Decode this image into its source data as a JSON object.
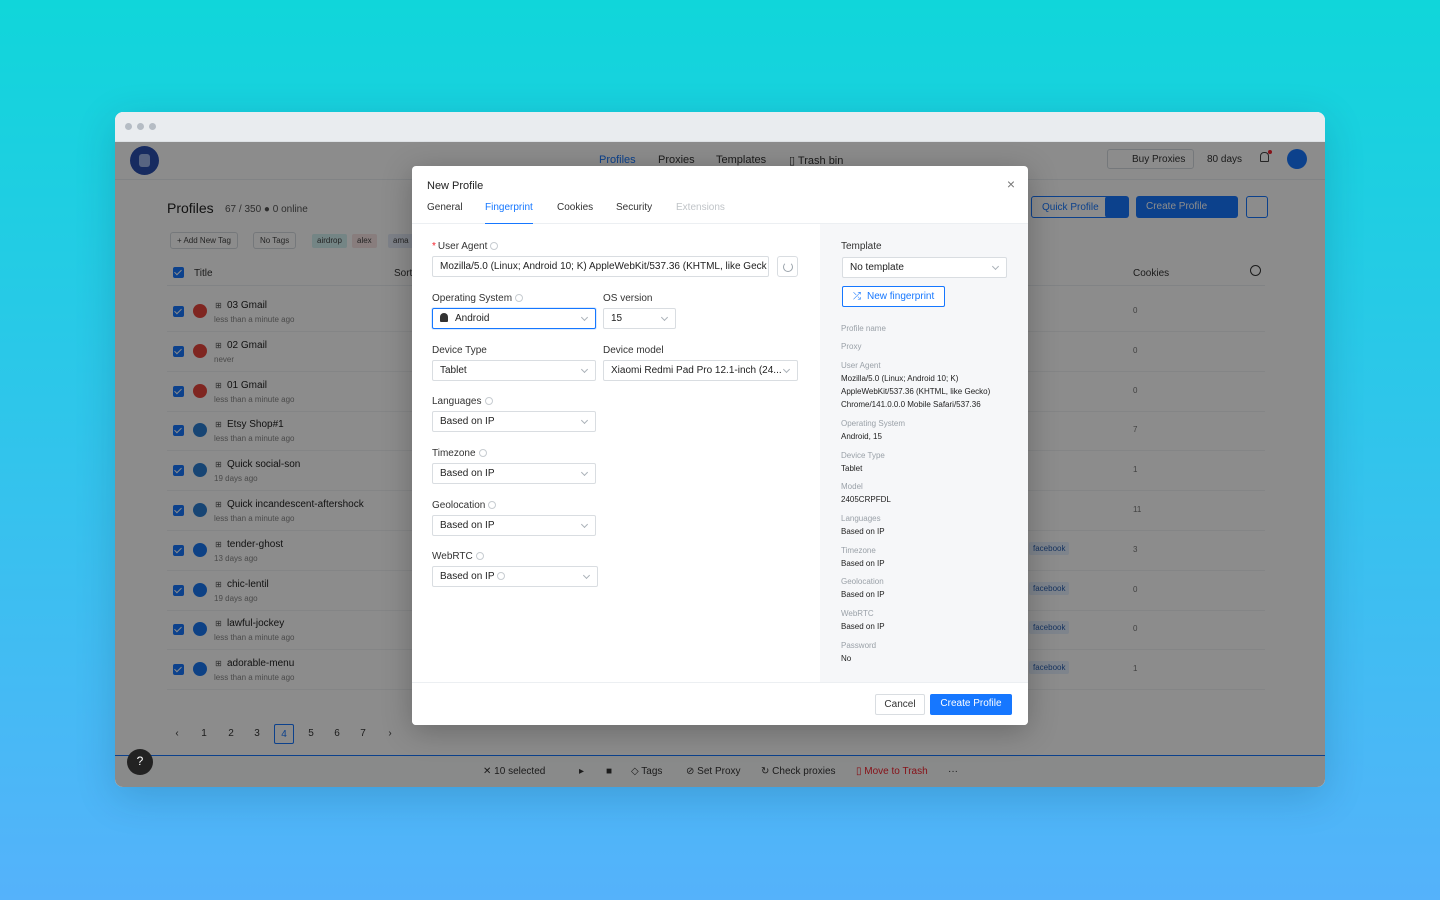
{
  "app": {
    "nav": [
      "Profiles",
      "Proxies",
      "Templates",
      "Trash bin"
    ],
    "buy_proxies": "Buy Proxies",
    "days": "80 days",
    "profiles_title": "Profiles",
    "profiles_count": "67 / 350",
    "online": "0 online",
    "add_new_tag": "Add New Tag",
    "no_tags": "No Tags",
    "chips": [
      "airdrop",
      "alex",
      "ama"
    ],
    "quick_profile": "Quick Profile",
    "create_profile": "Create Profile",
    "col_title": "Title",
    "col_sort": "Sort",
    "col_cookies": "Cookies",
    "rows": [
      {
        "title": "03 Gmail",
        "sub": "less than a minute ago",
        "cookies": "0",
        "tag": ""
      },
      {
        "title": "02 Gmail",
        "sub": "never",
        "cookies": "0",
        "tag": ""
      },
      {
        "title": "01 Gmail",
        "sub": "less than a minute ago",
        "cookies": "0",
        "tag": ""
      },
      {
        "title": "Etsy Shop#1",
        "sub": "less than a minute ago",
        "cookies": "7",
        "tag": ""
      },
      {
        "title": "Quick social-son",
        "sub": "19 days ago",
        "cookies": "1",
        "tag": ""
      },
      {
        "title": "Quick incandescent-aftershock",
        "sub": "less than a minute ago",
        "cookies": "11",
        "tag": ""
      },
      {
        "title": "tender-ghost",
        "sub": "13 days ago",
        "cookies": "3",
        "tag": "facebook"
      },
      {
        "title": "chic-lentil",
        "sub": "19 days ago",
        "cookies": "0",
        "tag": "facebook"
      },
      {
        "title": "lawful-jockey",
        "sub": "less than a minute ago",
        "cookies": "0",
        "tag": "facebook"
      },
      {
        "title": "adorable-menu",
        "sub": "less than a minute ago",
        "cookies": "1",
        "tag": "facebook"
      }
    ],
    "pages": [
      "1",
      "2",
      "3",
      "4",
      "5",
      "6",
      "7"
    ],
    "bottom": {
      "selected": "10 selected",
      "tags": "Tags",
      "set_proxy": "Set Proxy",
      "check_proxies": "Check proxies",
      "move_to_trash": "Move to Trash",
      "more": "···"
    },
    "help": "?"
  },
  "modal": {
    "title": "New Profile",
    "close": "×",
    "tabs": [
      "General",
      "Fingerprint",
      "Cookies",
      "Security",
      "Extensions"
    ],
    "user_agent_label": "User Agent",
    "user_agent_value": "Mozilla/5.0 (Linux; Android 10; K) AppleWebKit/537.36 (KHTML, like Geck",
    "os_label": "Operating System",
    "os_value": "Android",
    "os_version_label": "OS version",
    "os_version_value": "15",
    "device_type_label": "Device Type",
    "device_type_value": "Tablet",
    "device_model_label": "Device model",
    "device_model_value": "Xiaomi Redmi Pad Pro 12.1-inch (24...",
    "languages_label": "Languages",
    "languages_value": "Based on IP",
    "timezone_label": "Timezone",
    "timezone_value": "Based on IP",
    "geolocation_label": "Geolocation",
    "geolocation_value": "Based on IP",
    "webrtc_label": "WebRTC",
    "webrtc_value": "Based on IP",
    "template_label": "Template",
    "template_value": "No template",
    "new_fingerprint": "New fingerprint",
    "summary": {
      "profile_name": "Profile name",
      "proxy": "Proxy",
      "ua_label": "User Agent",
      "ua_line1": "Mozilla/5.0 (Linux; Android 10; K)",
      "ua_line2": "AppleWebKit/537.36 (KHTML, like Gecko)",
      "ua_line3": "Chrome/141.0.0.0 Mobile Safari/537.36",
      "os_label": "Operating System",
      "os_value": "Android, 15",
      "device_type_label": "Device Type",
      "device_type_value": "Tablet",
      "model_label": "Model",
      "model_value": "2405CRPFDL",
      "languages_label": "Languages",
      "languages_value": "Based on IP",
      "timezone_label": "Timezone",
      "timezone_value": "Based on IP",
      "geolocation_label": "Geolocation",
      "geolocation_value": "Based on IP",
      "webrtc_label": "WebRTC",
      "webrtc_value": "Based on IP",
      "password_label": "Password",
      "password_value": "No"
    },
    "cancel": "Cancel",
    "create": "Create Profile"
  },
  "colors": {
    "accent": "#1677ff",
    "background_top": "#10d6da",
    "background_bottom": "#55b2fb"
  }
}
